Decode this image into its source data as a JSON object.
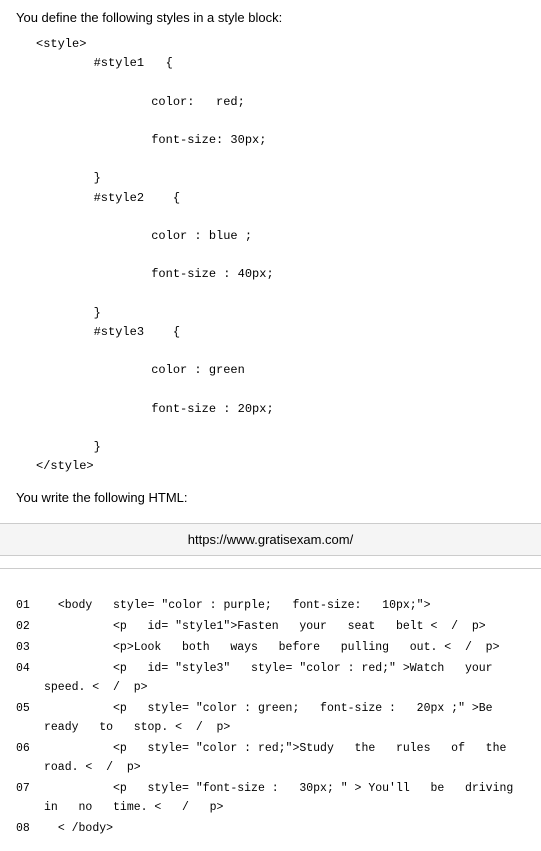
{
  "intro": {
    "text": "You define the following styles in a style block:"
  },
  "style_code": "<style>\n        #style1   {\n\n                color:   red;\n\n                font-size: 30px;\n\n        }\n        #style2    {\n\n                color : blue ;\n\n                font-size : 40px;\n\n        }\n        #style3    {\n\n                color : green\n\n                font-size : 20px;\n\n        }\n</style>",
  "html_label": "You write the following HTML:",
  "url": "https://www.gratisexam.com/",
  "lines": [
    {
      "num": "01",
      "content": "  <body   style= \"color : purple;   font-size:   10px;\">"
    },
    {
      "num": "02",
      "content": "          <p   id= \"style1\">Fasten   your   seat   belt <  /  p>"
    },
    {
      "num": "03",
      "content": "          <p>Look   both   ways   before   pulling   out. <  /  p>"
    },
    {
      "num": "04",
      "content": "          <p   id= \"style3\"   style= \"color : red;\" >Watch   your speed. <  /  p>"
    },
    {
      "num": "05",
      "content": "          <p   style= \"color : green;   font-size :   20px ;\" >Be ready   to   stop. <  /  p>"
    },
    {
      "num": "06",
      "content": "          <p   style= \"color : red;\">Study   the   rules   of   the road. <  /  p>"
    },
    {
      "num": "07",
      "content": "          <p   style= \"font-size :   30px; \" > You'll   be   driving in   no   time. <   /   p>"
    },
    {
      "num": "08",
      "content": "  < /body>"
    }
  ]
}
